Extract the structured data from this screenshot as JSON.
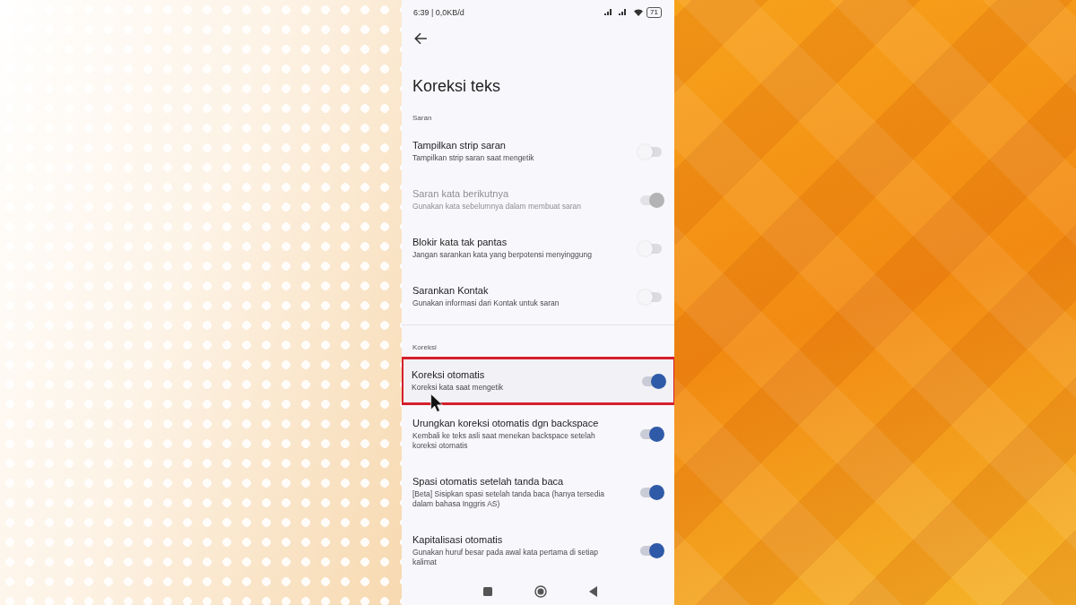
{
  "status_bar": {
    "left": "6:39 | 0,0KB/d",
    "battery": "71"
  },
  "title": "Koreksi teks",
  "sections": [
    {
      "header": "Saran",
      "items": [
        {
          "kind": "toggle",
          "title": "Tampilkan strip saran",
          "subtitle": "Tampilkan strip saran saat mengetik",
          "on": false,
          "disabled": false,
          "highlighted": false
        },
        {
          "kind": "toggle",
          "title": "Saran kata berikutnya",
          "subtitle": "Gunakan kata sebelumnya dalam membuat saran",
          "on": true,
          "disabled": true,
          "highlighted": false
        },
        {
          "kind": "toggle",
          "title": "Blokir kata tak pantas",
          "subtitle": "Jangan sarankan kata yang berpotensi menyinggung",
          "on": false,
          "disabled": false,
          "highlighted": false
        },
        {
          "kind": "toggle",
          "title": "Sarankan Kontak",
          "subtitle": "Gunakan informasi dari Kontak untuk saran",
          "on": false,
          "disabled": false,
          "highlighted": false
        }
      ]
    },
    {
      "header": "Koreksi",
      "items": [
        {
          "kind": "toggle",
          "title": "Koreksi otomatis",
          "subtitle": "Koreksi kata saat mengetik",
          "on": true,
          "disabled": false,
          "highlighted": true
        },
        {
          "kind": "toggle",
          "title": "Urungkan koreksi otomatis dgn backspace",
          "subtitle": "Kembali ke teks asli saat menekan backspace setelah koreksi otomatis",
          "on": true,
          "disabled": false,
          "highlighted": false
        },
        {
          "kind": "toggle",
          "title": "Spasi otomatis setelah tanda baca",
          "subtitle": "[Beta] Sisipkan spasi setelah tanda baca (hanya tersedia dalam bahasa Inggris AS)",
          "on": true,
          "disabled": false,
          "highlighted": false
        },
        {
          "kind": "toggle",
          "title": "Kapitalisasi otomatis",
          "subtitle": "Gunakan huruf besar pada awal kata pertama di setiap kalimat",
          "on": true,
          "disabled": false,
          "highlighted": false
        }
      ]
    }
  ]
}
